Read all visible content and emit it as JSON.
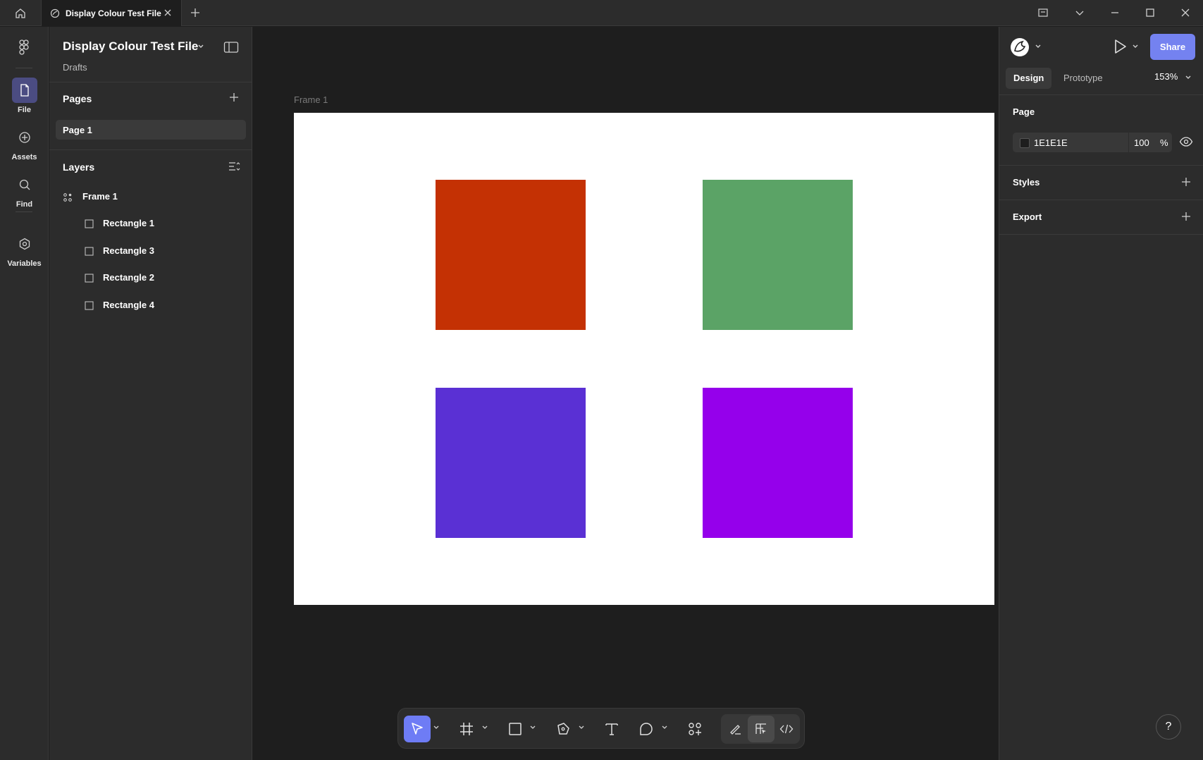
{
  "titlebar": {
    "tab_title": "Display Colour Test File",
    "icons": [
      "home-icon",
      "figma-tab-icon",
      "close-icon",
      "plus-icon",
      "window-icon",
      "chevron-down-icon",
      "minimize-icon",
      "maximize-icon",
      "window-close-icon"
    ]
  },
  "rail": {
    "items": [
      {
        "label": "File",
        "icon": "file-icon"
      },
      {
        "label": "Assets",
        "icon": "assets-icon"
      },
      {
        "label": "Find",
        "icon": "search-icon"
      },
      {
        "label": "Variables",
        "icon": "variables-icon"
      }
    ]
  },
  "left_panel": {
    "file_name": "Display Colour Test File",
    "location": "Drafts",
    "pages_heading": "Pages",
    "pages": [
      "Page 1"
    ],
    "layers_heading": "Layers",
    "layers": [
      {
        "label": "Frame 1",
        "type": "frame"
      },
      {
        "label": "Rectangle 1",
        "type": "rectangle"
      },
      {
        "label": "Rectangle 3",
        "type": "rectangle"
      },
      {
        "label": "Rectangle 2",
        "type": "rectangle"
      },
      {
        "label": "Rectangle 4",
        "type": "rectangle"
      }
    ]
  },
  "canvas": {
    "frame_label": "Frame 1",
    "frame_color": "#ffffff",
    "rectangles": [
      {
        "name": "Rectangle 1",
        "color": "#C43104"
      },
      {
        "name": "Rectangle 3",
        "color": "#5BA366"
      },
      {
        "name": "Rectangle 2",
        "color": "#5A30D4"
      },
      {
        "name": "Rectangle 4",
        "color": "#9500EB"
      }
    ]
  },
  "toolbar": {
    "tools": [
      "move-tool-icon",
      "frame-tool-icon",
      "rectangle-tool-icon",
      "pen-tool-icon",
      "text-tool-icon",
      "comment-tool-icon",
      "actions-icon",
      "draw-mode-icon",
      "design-mode-icon",
      "dev-mode-icon"
    ]
  },
  "right_panel": {
    "share_label": "Share",
    "tabs": [
      "Design",
      "Prototype"
    ],
    "zoom": "153%",
    "page_heading": "Page",
    "page_color_hex": "1E1E1E",
    "page_opacity": "100",
    "opacity_unit": "%",
    "styles_heading": "Styles",
    "export_heading": "Export",
    "help_label": "?",
    "accent_color": "#7482f0"
  }
}
